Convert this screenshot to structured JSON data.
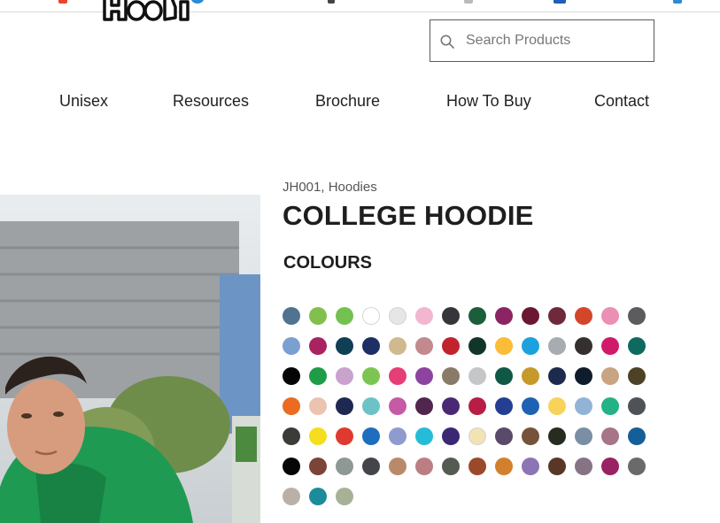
{
  "header": {
    "search": {
      "placeholder": "Search Products",
      "value": ""
    }
  },
  "nav": {
    "items": [
      {
        "id": "unisex",
        "label": "Unisex"
      },
      {
        "id": "resources",
        "label": "Resources"
      },
      {
        "id": "brochure",
        "label": "Brochure"
      },
      {
        "id": "how-to-buy",
        "label": "How To Buy"
      },
      {
        "id": "contact",
        "label": "Contact"
      }
    ]
  },
  "product": {
    "meta": "JH001, Hoodies",
    "title": "COLLEGE HOODIE",
    "colours_heading": "COLOURS",
    "colours": [
      [
        "#4f7391",
        "#81c04e",
        "#74c151",
        "#ffffff",
        "#e6e6e4",
        "#f2b6d0",
        "#36353a",
        "#1b5e3c",
        "#8a2462",
        "#6b1733",
        "#6e2a3b",
        "#d2472b",
        "#ec8fb4",
        "#5d5b5e"
      ],
      [
        "#7c9fd1",
        "#a8235f",
        "#0f3e55",
        "#1d2f63",
        "#d1b98f",
        "#c28a8c",
        "#c1232e",
        "#12352a",
        "#fbbd37",
        "#1da1de",
        "#a7abb2",
        "#35302f",
        "#d01b6b",
        "#0e6a5f"
      ],
      [
        "#050505",
        "#1e9c48",
        "#c9a2cd",
        "#7dc553",
        "#e63e78",
        "#8d44a0",
        "#8a7a68",
        "#c4c6c8",
        "#0e5845",
        "#c59a2a",
        "#1e2a4d",
        "#0f1c2c",
        "#c8a482",
        "#4d4226"
      ],
      [
        "#ea6b21",
        "#ebc3ae",
        "#1f2850",
        "#6cc3c6",
        "#c55ba7",
        "#50254e",
        "#4a2874",
        "#b81e45",
        "#243f92",
        "#1e63b3",
        "#f8d35a",
        "#93b3d6",
        "#22b286",
        "#4f5256"
      ],
      [
        "#3b3b38",
        "#f4de1d",
        "#df3a2f",
        "#1f6dbf",
        "#8f9bcd",
        "#26bcd9",
        "#3b2774",
        "#f3e2b2",
        "#5a4a6a",
        "#76523a",
        "#262c1f",
        "#7a8fa4",
        "#a67587",
        "#155f99"
      ],
      [
        "#060606",
        "#7b4438",
        "#8e9894",
        "#43454a",
        "#b98a6a",
        "#bb7f83",
        "#545b52",
        "#9a4a2a",
        "#d1812e",
        "#8c75b4",
        "#583727",
        "#867485",
        "#992262",
        "#6a6a6a"
      ],
      [
        "#b9b1a8",
        "#1b8c9a",
        "#a7b196"
      ]
    ]
  }
}
